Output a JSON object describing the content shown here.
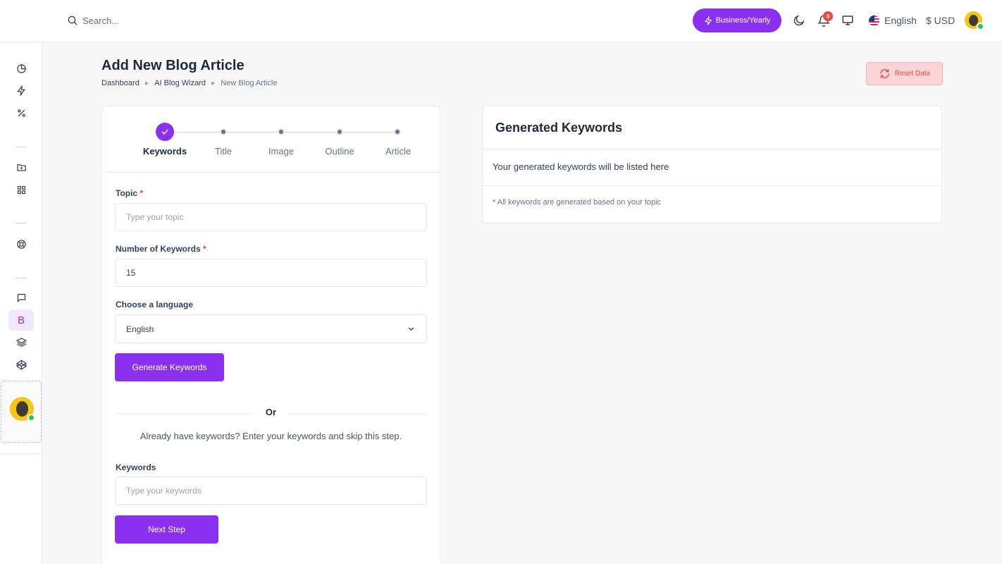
{
  "topbar": {
    "search_placeholder": "Search...",
    "plan_label": "Business/Yearly",
    "notification_count": "0",
    "language": "English",
    "currency": "$ USD"
  },
  "page": {
    "title": "Add New Blog Article",
    "breadcrumb": [
      "Dashboard",
      "AI Blog Wizard",
      "New Blog Article"
    ],
    "reset_label": "Reset Data"
  },
  "sidebar": {
    "active_letter": "B"
  },
  "stepper": {
    "steps": [
      "Keywords",
      "Title",
      "Image",
      "Outline",
      "Article"
    ],
    "active_index": 0
  },
  "form": {
    "topic_label": "Topic",
    "topic_placeholder": "Type your topic",
    "required_mark": "*",
    "num_keywords_label": "Number of Keywords",
    "num_keywords_value": "15",
    "language_label": "Choose a language",
    "language_value": "English",
    "generate_label": "Generate Keywords",
    "or_text": "Or",
    "skip_text": "Already have keywords? Enter your keywords and skip this step.",
    "keywords_label": "Keywords",
    "keywords_placeholder": "Type your keywords",
    "next_label": "Next Step"
  },
  "results": {
    "title": "Generated Keywords",
    "empty_text": "Your generated keywords will be listed here",
    "note": "* All keywords are generated based on your topic"
  },
  "colors": {
    "accent": "#8b2ff0",
    "danger": "#ef4444",
    "online": "#22c55e"
  }
}
